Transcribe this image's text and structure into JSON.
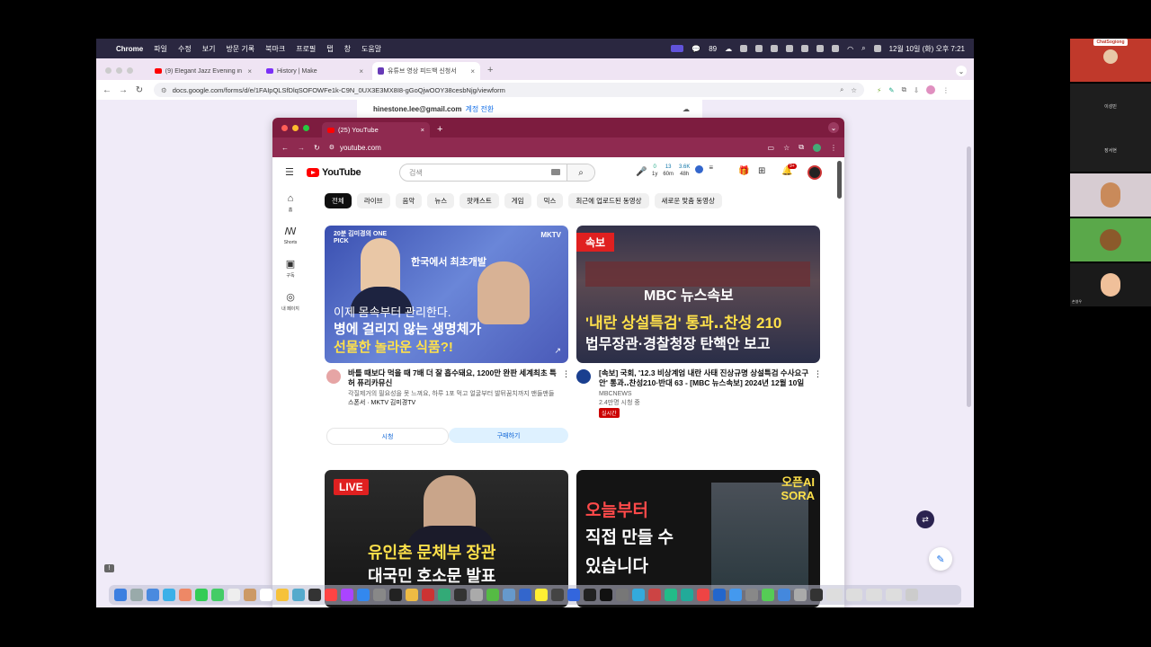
{
  "menubar": {
    "app": "Chrome",
    "items": [
      "파일",
      "수정",
      "보기",
      "방문 기록",
      "북마크",
      "프로필",
      "탭",
      "창",
      "도움말"
    ],
    "battery_count": "89",
    "datetime": "12월 10일 (화) 오후 7:21"
  },
  "outer_tabs": [
    {
      "label": "(9) Elegant Jazz Evening in N",
      "color": "#ff0000"
    },
    {
      "label": "History | Make",
      "color": "#7b2ff7"
    },
    {
      "label": "유튜브 영상 피드백 신청서",
      "color": "#673ab7"
    }
  ],
  "outer_address": {
    "url": "docs.google.com/forms/d/e/1FAIpQLSfDlqSOFOWFe1k-C9N_0UX3E3MX8I8-gGoQjwOOY38cesbNjg/viewform"
  },
  "form": {
    "email": "hinestone.lee@gmail.com",
    "switch_account": "계정 전환"
  },
  "yt_window": {
    "tab_label": "(25) YouTube",
    "url": "youtube.com",
    "logo_text": "YouTube",
    "search_placeholder": "검색",
    "stats": [
      {
        "top": "0",
        "bottom": "1y"
      },
      {
        "top": "13",
        "bottom": "60m"
      },
      {
        "top": "3.6K",
        "bottom": "48h"
      }
    ],
    "notif_count": "9+",
    "sidebar": [
      {
        "icon": "home-icon",
        "label": "홈"
      },
      {
        "icon": "shorts-icon",
        "label": "Shorts"
      },
      {
        "icon": "subscriptions-icon",
        "label": "구독"
      },
      {
        "icon": "profile-icon",
        "label": "내 페이지"
      }
    ],
    "chips": [
      "전체",
      "라이브",
      "음악",
      "뉴스",
      "팟캐스트",
      "게임",
      "믹스",
      "최근에 업로드된 동영상",
      "새로운 맞춤 동영상"
    ],
    "videos": [
      {
        "title": "바를 때보다 먹을 때 7배 더 잘 흡수돼요, 1200만 완판 세계최초 특허 퓨리카뮤신",
        "description": "각질제거의 필요성을 못 느껴요, 하루 1포 먹고 얼굴부터 발뒤꿈치까지 맨들맨들",
        "channel": "스폰서 · MKTV 김미경TV",
        "btn_watch": "시청",
        "btn_buy": "구매하기",
        "thumb_top": "20분 김미경의 ONE PICK",
        "thumb_brand": "MKTV",
        "thumb_caption1": "한국에서 최초개발",
        "thumb_caption2": "이제 몸속부터 관리한다.",
        "thumb_caption3": "병에 걸리지 않는 생명체가",
        "thumb_caption4": "선물한 놀라운 식품?!"
      },
      {
        "title": "[속보] 국회, '12.3 비상계엄 내란 사태 진상규명 상설특검 수사요구안' 통과‥찬성210·반대 63 - [MBC 뉴스속보] 2024년 12월 10일",
        "channel": "MBCNEWS",
        "views": "2.4만명 시청 중",
        "live_badge": "실시간",
        "thumb_tag": "속보",
        "thumb_brand": "MBC 뉴스속보",
        "thumb_caption1": "'내란 상설특검' 통과‥찬성 210",
        "thumb_caption2": "법무장관·경찰청장 탄핵안 보고"
      },
      {
        "thumb_tag": "LIVE",
        "thumb_caption1": "유인촌 문체부 장관",
        "thumb_caption2": "대국민 호소문 발표"
      },
      {
        "thumb_caption1": "오늘부터",
        "thumb_caption2": "직접 만들 수",
        "thumb_caption3": "있습니다",
        "thumb_tag": "오픈AI SORA"
      }
    ]
  },
  "participants": [
    "ChatSogiong",
    "이성민",
    "장서현",
    "손영우"
  ]
}
